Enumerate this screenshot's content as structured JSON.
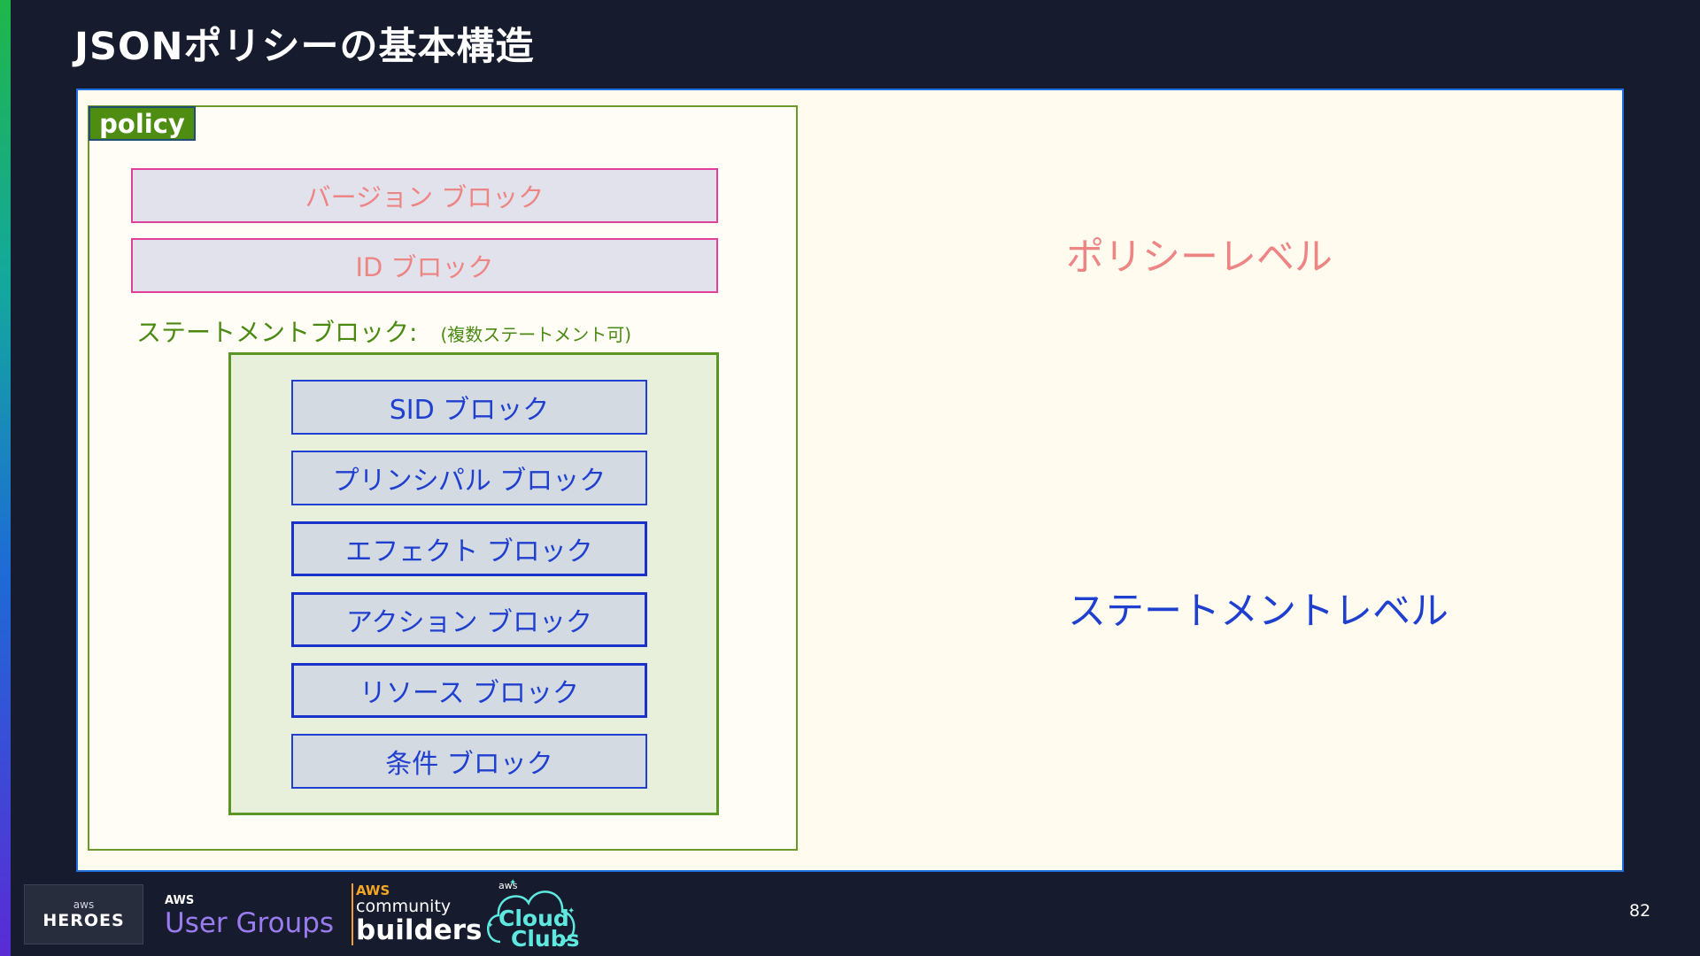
{
  "page": {
    "title": "JSONポリシーの基本構造",
    "page_number": "82"
  },
  "diagram": {
    "policy_tag": "policy",
    "policy_blocks": [
      "バージョン ブロック",
      "ID ブロック"
    ],
    "statement_label": "ステートメントブロック:",
    "statement_sublabel": "(複数ステートメント可)",
    "statement_blocks": [
      "SID ブロック",
      "プリンシパル ブロック",
      "エフェクト ブロック",
      "アクション ブロック",
      "リソース ブロック",
      "条件 ブロック"
    ],
    "policy_level_label": "ポリシーレベル",
    "statement_level_label": "ステートメントレベル"
  },
  "footer": {
    "heroes_small": "aws",
    "heroes_big": "HEROES",
    "usergroups_aws": "AWS",
    "usergroups_name": "User Groups",
    "builders_aws": "AWS",
    "builders_community": "community",
    "builders_name": "builders",
    "cloud_aws": "aws",
    "cloud_line1": "Cloud",
    "cloud_line2": "Clubs"
  },
  "colors": {
    "background": "#161c2d",
    "canvas": "#fffbef",
    "policy_green": "#4e8d12",
    "pink_text": "#ee8585",
    "pink_border": "#e0409a",
    "blue": "#1f3fcf"
  }
}
